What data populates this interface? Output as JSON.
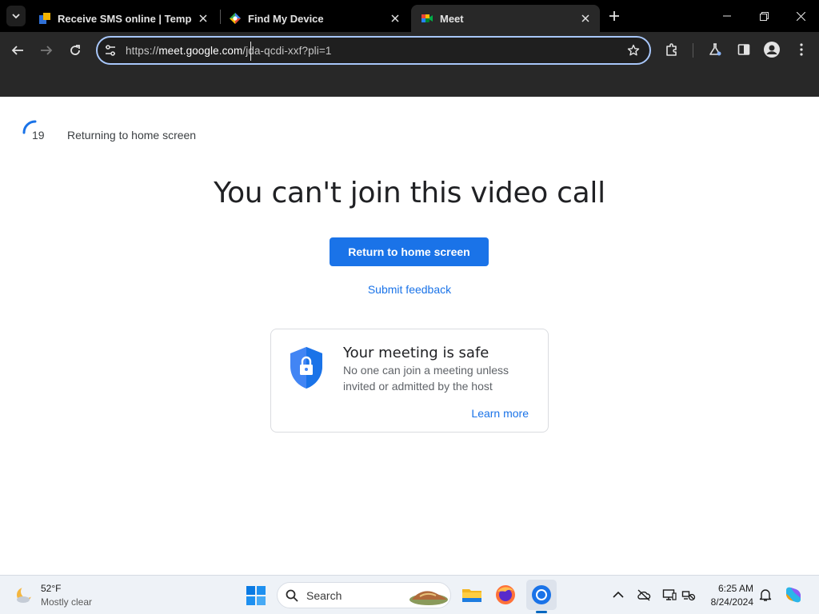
{
  "browser": {
    "tabs": [
      {
        "title": "Receive SMS online | Temporar",
        "active": false
      },
      {
        "title": "Find My Device",
        "active": false
      },
      {
        "title": "Meet",
        "active": true
      }
    ],
    "url_prefix": "https://",
    "url_host": "meet.google.com",
    "url_path": "/jda-qcdi-xxf?pli=1"
  },
  "page": {
    "countdown_value": "19",
    "countdown_text": "Returning to home screen",
    "headline": "You can't join this video call",
    "return_button": "Return to home screen",
    "feedback_link": "Submit feedback",
    "safe_card": {
      "title": "Your meeting is safe",
      "description": "No one can join a meeting unless invited or admitted by the host",
      "learn_more": "Learn more"
    }
  },
  "taskbar": {
    "weather_temp": "52°F",
    "weather_desc": "Mostly clear",
    "search_placeholder": "Search",
    "time": "6:25 AM",
    "date": "8/24/2024"
  },
  "colors": {
    "accent": "#1a73e8",
    "omnibox_focus": "#a8c7fa",
    "chrome_dark": "#282828",
    "shield": "#4285f4"
  },
  "icons": [
    "tab-search-icon",
    "sms-favicon",
    "find-my-device-favicon",
    "meet-favicon",
    "close-icon",
    "new-tab-icon",
    "minimize-icon",
    "restore-icon",
    "window-close-icon",
    "back-icon",
    "forward-icon",
    "reload-icon",
    "tune-icon",
    "star-icon",
    "extensions-icon",
    "labs-icon",
    "side-panel-icon",
    "profile-icon",
    "menu-icon",
    "countdown-ring-icon",
    "shield-lock-icon",
    "weather-icon",
    "windows-start-icon",
    "search-icon",
    "file-explorer-icon",
    "firefox-icon",
    "chrome-icon",
    "chevron-up-icon",
    "cloud-off-icon",
    "display-icon",
    "network-icon",
    "bell-icon",
    "copilot-icon"
  ]
}
